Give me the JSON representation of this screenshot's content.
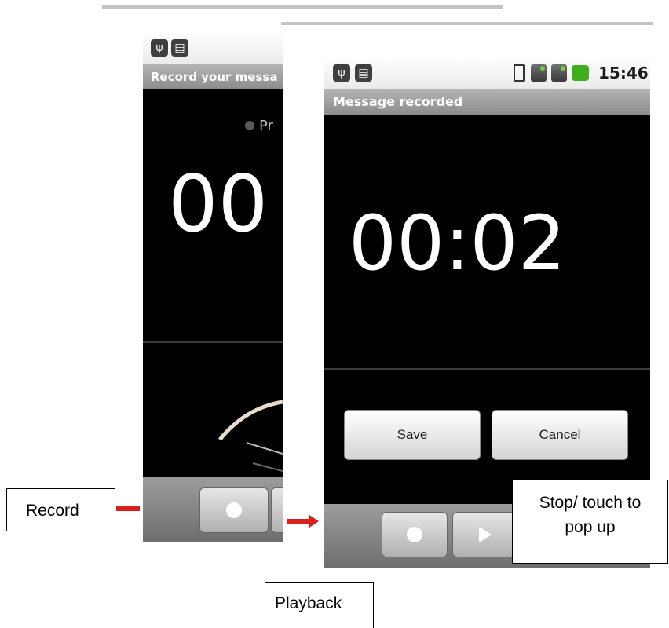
{
  "back_screen": {
    "title": "Record your messa",
    "status": "Pr",
    "timer": "00"
  },
  "front_screen": {
    "clock": "15:46",
    "title": "Message recorded",
    "timer": "00:02",
    "save_label": "Save",
    "cancel_label": "Cancel"
  },
  "callouts": {
    "record": "Record",
    "playback": "Playback",
    "stop_line1": "Stop/ touch to",
    "stop_line2": "pop up"
  },
  "colors": {
    "arrow": "#d9201a",
    "status_dot": "#5a5a5a",
    "battery": "#3fae1e"
  },
  "icons": [
    "usb-icon",
    "android-icon",
    "sim-icon",
    "signal-icon",
    "battery-icon",
    "record-icon",
    "play-icon"
  ]
}
